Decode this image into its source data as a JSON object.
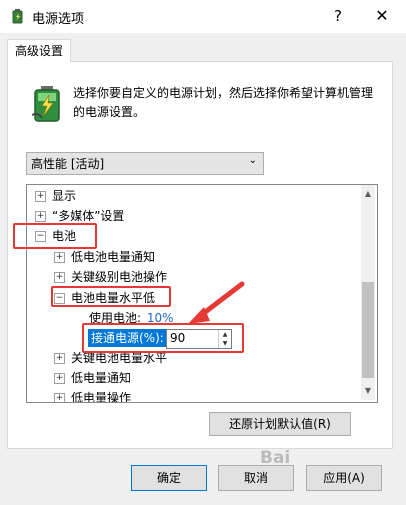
{
  "window": {
    "title": "电源选项",
    "help": "?",
    "close": "✕"
  },
  "tab": {
    "label": "高级设置"
  },
  "description": "选择你要自定义的电源计划，然后选择你希望计算机管理的电源设置。",
  "plan_select": {
    "value": "高性能 [活动]"
  },
  "tree": {
    "items": [
      {
        "label": "显示",
        "expander": "⊞"
      },
      {
        "label": "“多媒体”设置",
        "expander": "⊞"
      },
      {
        "label": "电池",
        "expander": "⊟"
      },
      {
        "label": "低电池电量通知",
        "expander": "⊞"
      },
      {
        "label": "关键级别电池操作",
        "expander": "⊞"
      },
      {
        "label": "电池电量水平低",
        "expander": "⊟"
      },
      {
        "label": "关键电池电量水平",
        "expander": "⊞"
      },
      {
        "label": "低电量通知",
        "expander": "⊞"
      },
      {
        "label": "低电量操作",
        "expander": "⊞"
      }
    ],
    "on_battery": {
      "label": "使用电池:",
      "value": "10%"
    },
    "plugged_in": {
      "label": "接通电源(%):",
      "value": "90"
    }
  },
  "buttons": {
    "restore": "还原计划默认值(R)",
    "ok": "确定",
    "cancel": "取消",
    "apply": "应用(A)"
  },
  "watermark": "Bai",
  "colors": {
    "accent": "#0078d7",
    "highlight": "#e53935",
    "link": "#1e6ac4"
  }
}
